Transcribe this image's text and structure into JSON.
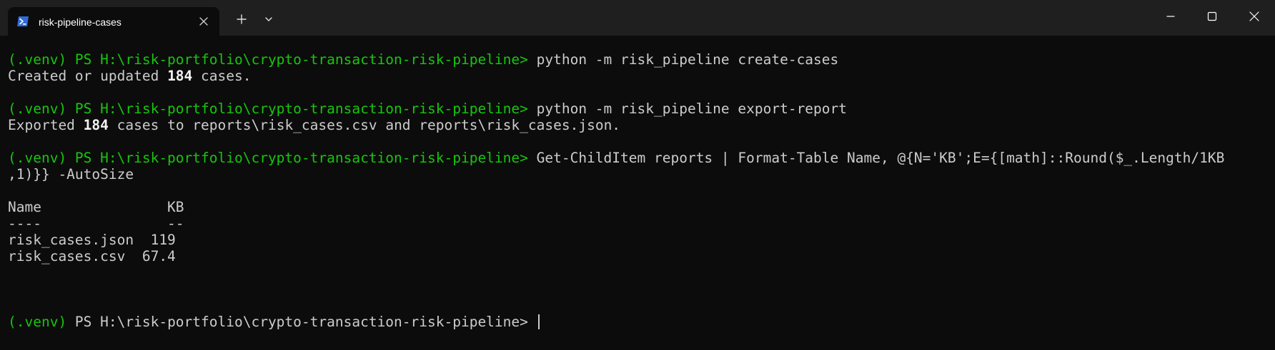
{
  "tab": {
    "title": "risk-pipeline-cases",
    "icon": "powershell-icon"
  },
  "titlebar": {
    "new_tab_icon": "plus-icon",
    "dropdown_icon": "chevron-down-icon",
    "minimize_icon": "minimize-icon",
    "maximize_icon": "maximize-icon",
    "close_icon": "close-icon"
  },
  "colors": {
    "background": "#0c0c0c",
    "titlebar": "#1f1f1f",
    "prompt": "#16c60c",
    "text": "#cccccc"
  },
  "terminal": {
    "lines": [
      {
        "type": "cmd",
        "prompt": "(.venv) PS H:\\risk-portfolio\\crypto-transaction-risk-pipeline>",
        "command": " python -m risk_pipeline create-cases"
      },
      {
        "type": "out",
        "parts": [
          "Created or updated ",
          "184",
          " cases."
        ]
      },
      {
        "type": "blank"
      },
      {
        "type": "cmd",
        "prompt": "(.venv) PS H:\\risk-portfolio\\crypto-transaction-risk-pipeline>",
        "command": " python -m risk_pipeline export-report"
      },
      {
        "type": "out",
        "parts": [
          "Exported ",
          "184",
          " cases to reports\\risk_cases.csv and reports\\risk_cases.json."
        ]
      },
      {
        "type": "blank"
      },
      {
        "type": "cmd",
        "prompt": "(.venv) PS H:\\risk-portfolio\\crypto-transaction-risk-pipeline>",
        "command": " Get-ChildItem reports | Format-Table Name, @{N='KB';E={[math]::Round($_.Length/1KB"
      },
      {
        "type": "plain",
        "text": ",1)}} -AutoSize"
      },
      {
        "type": "blank"
      },
      {
        "type": "plain",
        "text": "Name               KB"
      },
      {
        "type": "plain",
        "text": "----               --"
      },
      {
        "type": "plain",
        "text": "risk_cases.json  119"
      },
      {
        "type": "plain",
        "text": "risk_cases.csv  67.4"
      },
      {
        "type": "blank"
      },
      {
        "type": "blank"
      },
      {
        "type": "blank"
      },
      {
        "type": "final",
        "prompt_green": "(.venv)",
        "prompt_rest": " PS H:\\risk-portfolio\\crypto-transaction-risk-pipeline>"
      }
    ]
  }
}
